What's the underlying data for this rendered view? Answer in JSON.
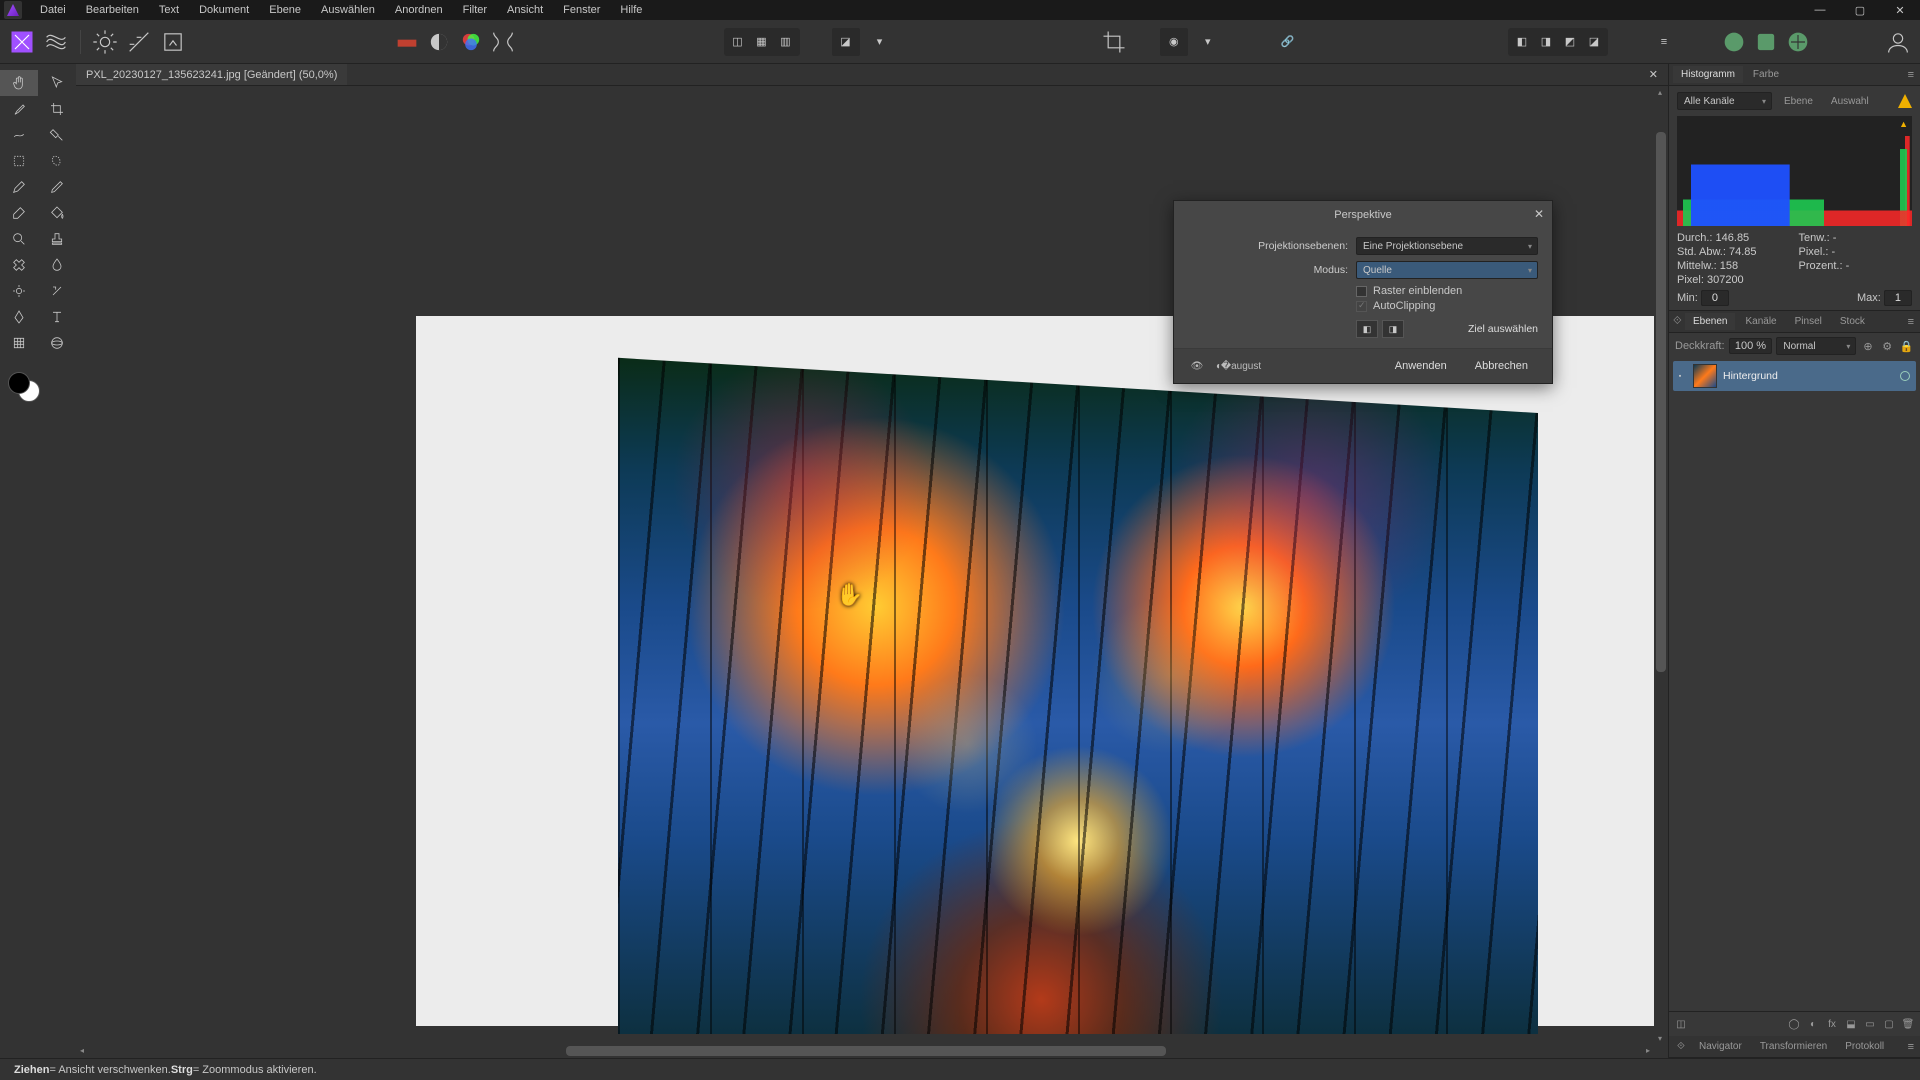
{
  "menu": [
    "Datei",
    "Bearbeiten",
    "Text",
    "Dokument",
    "Ebene",
    "Auswählen",
    "Anordnen",
    "Filter",
    "Ansicht",
    "Fenster",
    "Hilfe"
  ],
  "doc_tab": "PXL_20230127_135623241.jpg [Geändert] (50,0%)",
  "dialog": {
    "title": "Perspektive",
    "proj_label": "Projektionsebenen:",
    "proj_value": "Eine Projektionsebene",
    "mode_label": "Modus:",
    "mode_value": "Quelle",
    "check_grid": "Raster einblenden",
    "check_clip": "AutoClipping",
    "select_target": "Ziel auswählen",
    "apply": "Anwenden",
    "cancel": "Abbrechen"
  },
  "hist": {
    "tab1": "Histogramm",
    "tab2": "Farbe",
    "channels": "Alle Kanäle",
    "btn_layer": "Ebene",
    "btn_sel": "Auswahl",
    "stats": {
      "durch_l": "Durch.:",
      "durch_v": "146.85",
      "tenw_l": "Tenw.:",
      "tenw_v": "-",
      "std_l": "Std. Abw.:",
      "std_v": "74.85",
      "pixel2_l": "Pixel.:",
      "pixel2_v": "-",
      "mittelw_l": "Mittelw.:",
      "mittelw_v": "158",
      "proz_l": "Prozent.:",
      "proz_v": "-",
      "pixel_l": "Pixel:",
      "pixel_v": "307200"
    },
    "min_l": "Min:",
    "min_v": "0",
    "max_l": "Max:",
    "max_v": "1"
  },
  "layers": {
    "tabs": [
      "Ebenen",
      "Kanäle",
      "Pinsel",
      "Stock"
    ],
    "opacity_l": "Deckkraft:",
    "opacity_v": "100 %",
    "blend": "Normal",
    "layer0": "Hintergrund",
    "bottom_tabs": [
      "Navigator",
      "Transformieren",
      "Protokoll"
    ]
  },
  "status": {
    "k1": "Ziehen",
    "t1": " = Ansicht verschwenken. ",
    "k2": "Strg",
    "t2": " = Zoommodus aktivieren."
  }
}
